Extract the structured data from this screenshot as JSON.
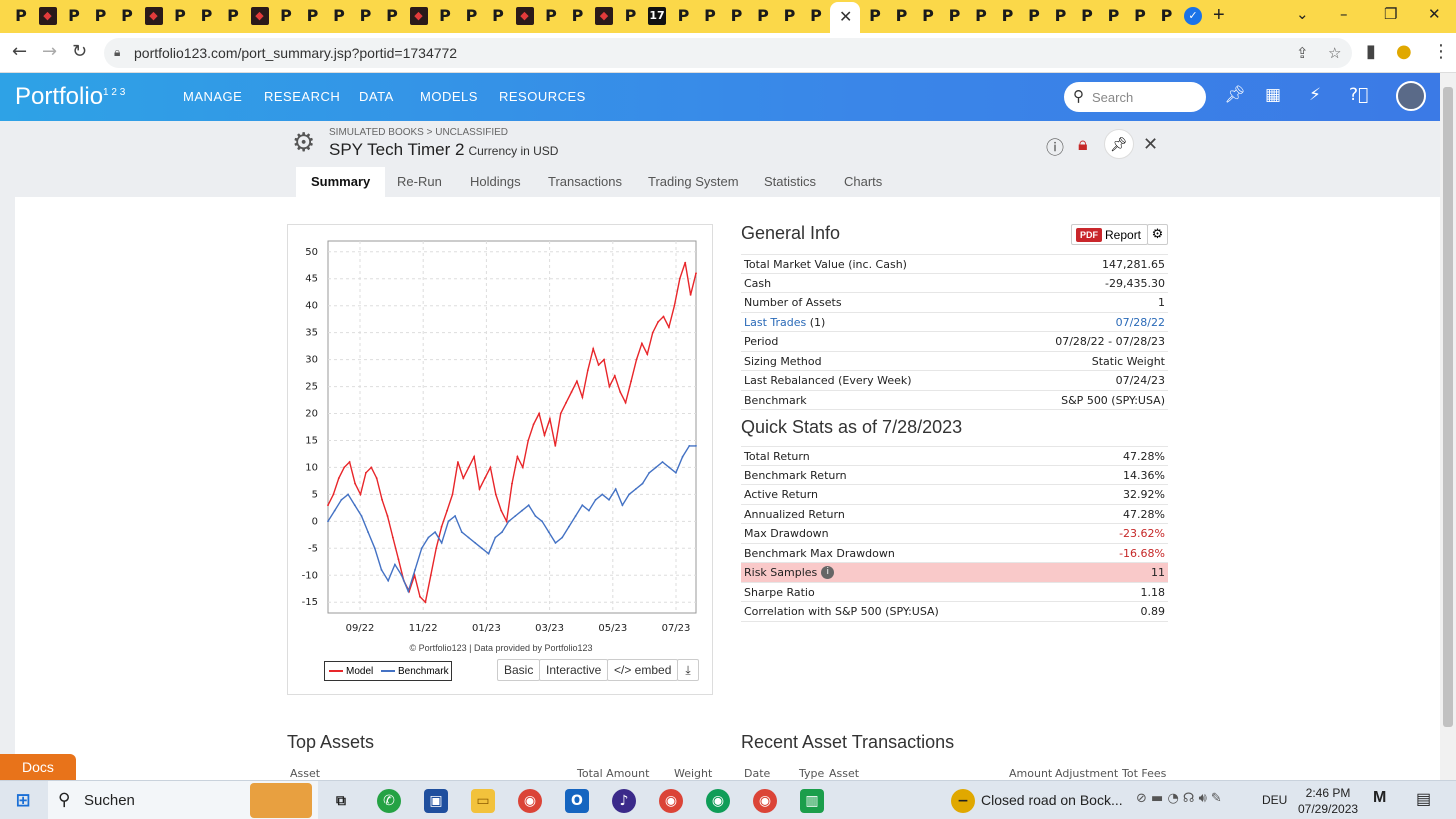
{
  "browser": {
    "tab_favicons": [
      "P",
      "r",
      "P",
      "P",
      "P",
      "r",
      "P",
      "P",
      "P",
      "r",
      "P",
      "P",
      "P",
      "P",
      "P",
      "r",
      "P",
      "P",
      "P",
      "r",
      "P",
      "P",
      "r",
      "P",
      "17",
      "P",
      "P",
      "P",
      "P",
      "P",
      "P",
      "P",
      "P",
      "P",
      "P",
      "P",
      "P",
      "P",
      "P",
      "P",
      "P",
      "P",
      "P",
      "g"
    ],
    "active_tab_close": "✕",
    "new_tab": "+",
    "url": "portfolio123.com/port_summary.jsp?portid=1734772"
  },
  "app": {
    "logo": "Portfolio",
    "logo_sup": "1 2 3",
    "nav": [
      "MANAGE",
      "RESEARCH",
      "DATA",
      "MODELS",
      "RESOURCES"
    ],
    "search_placeholder": "Search"
  },
  "portfolio": {
    "breadcrumb": "SIMULATED BOOKS > UNCLASSIFIED",
    "name": "SPY Tech Timer 2",
    "currency": "Currency in USD"
  },
  "tabs": [
    "Summary",
    "Re-Run",
    "Holdings",
    "Transactions",
    "Trading System",
    "Statistics",
    "Charts"
  ],
  "chart": {
    "credit": "© Portfolio123 | Data provided by Portfolio123",
    "legend_model": "Model",
    "legend_benchmark": "Benchmark",
    "buttons": [
      "Basic",
      "Interactive",
      "</> embed"
    ],
    "colors": {
      "model": "#e8262a",
      "benchmark": "#4472c4"
    }
  },
  "chart_data": {
    "type": "line",
    "x_tick_labels": [
      "09/22",
      "11/22",
      "01/23",
      "03/23",
      "05/23",
      "07/23"
    ],
    "y_ticks": [
      50,
      45,
      40,
      35,
      30,
      25,
      20,
      15,
      10,
      5,
      0,
      -5,
      -10,
      -15
    ],
    "ylim": [
      -17,
      52
    ],
    "grid": true,
    "legend_placement": "bottom-left",
    "series": [
      {
        "name": "Model",
        "values": [
          3,
          5,
          8,
          10,
          11,
          7,
          5,
          9,
          10,
          8,
          4,
          1,
          -3,
          -7,
          -11,
          -13,
          -10,
          -14,
          -15,
          -10,
          -5,
          -1,
          2,
          5,
          11,
          8,
          10,
          12,
          6,
          8,
          10,
          5,
          2,
          0,
          7,
          12,
          10,
          15,
          18,
          20,
          16,
          19,
          14,
          20,
          22,
          24,
          26,
          23,
          28,
          32,
          29,
          30,
          25,
          27,
          24,
          22,
          26,
          30,
          33,
          31,
          35,
          37,
          38,
          36,
          40,
          45,
          48,
          42,
          46
        ]
      },
      {
        "name": "Benchmark",
        "values": [
          0,
          2,
          4,
          5,
          3,
          1,
          -2,
          -5,
          -9,
          -11,
          -8,
          -10,
          -13,
          -9,
          -5,
          -3,
          -2,
          -4,
          0,
          1,
          -2,
          -3,
          -4,
          -5,
          -6,
          -3,
          -2,
          0,
          1,
          2,
          3,
          1,
          0,
          -2,
          -4,
          -3,
          -1,
          1,
          3,
          2,
          4,
          5,
          4,
          6,
          3,
          5,
          6,
          7,
          9,
          10,
          11,
          10,
          9,
          12,
          14,
          14
        ]
      }
    ]
  },
  "general_info": {
    "title": "General Info",
    "pdf_badge": "PDF",
    "report_label": "Report",
    "rows": [
      {
        "k": "Total Market Value (inc. Cash)",
        "v": "147,281.65"
      },
      {
        "k": "Cash",
        "v": "-29,435.30"
      },
      {
        "k": "Number of Assets",
        "v": "1"
      },
      {
        "k": "Last Trades",
        "k2": "(1)",
        "v": "07/28/22"
      },
      {
        "k": "Period",
        "v": "07/28/22 - 07/28/23"
      },
      {
        "k": "Sizing Method",
        "v": "Static Weight"
      },
      {
        "k": "Last Rebalanced (Every Week)",
        "v": "07/24/23"
      },
      {
        "k": "Benchmark",
        "v": "S&P 500 (SPY:USA)"
      }
    ]
  },
  "quick_stats": {
    "title": "Quick Stats as of 7/28/2023",
    "rows": [
      {
        "k": "Total Return",
        "v": "47.28%"
      },
      {
        "k": "Benchmark Return",
        "v": "14.36%"
      },
      {
        "k": "Active Return",
        "v": "32.92%"
      },
      {
        "k": "Annualized Return",
        "v": "47.28%"
      },
      {
        "k": "Max Drawdown",
        "v": "-23.62%"
      },
      {
        "k": "Benchmark Max Drawdown",
        "v": "-16.68%"
      },
      {
        "k": "Risk Samples",
        "v": "11"
      },
      {
        "k": "Sharpe Ratio",
        "v": "1.18"
      },
      {
        "k": "Correlation with S&P 500 (SPY:USA)",
        "v": "0.89"
      }
    ]
  },
  "top_assets": {
    "title": "Top Assets",
    "headers": [
      "Asset",
      "Total Amount",
      "Weight"
    ]
  },
  "recent_tx": {
    "title": "Recent Asset Transactions",
    "headers": [
      "Date",
      "Type",
      "Asset",
      "Amount",
      "Adjustment",
      "Tot Fees"
    ]
  },
  "docs_label": "Docs",
  "taskbar": {
    "search": "Suchen",
    "news": "Closed road on Bock...",
    "lang": "DEU",
    "time": "2:46 PM",
    "date": "07/29/2023"
  }
}
